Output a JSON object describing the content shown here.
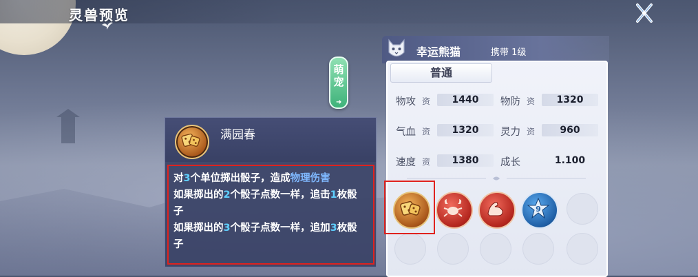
{
  "header": {
    "title": "灵兽预览"
  },
  "cute_tag": {
    "label": "萌宠"
  },
  "skill_popup": {
    "name": "满园春",
    "lines": [
      {
        "parts": [
          {
            "t": "对"
          },
          {
            "t": "3",
            "c": "cyan"
          },
          {
            "t": "个单位掷出骰子，造成"
          },
          {
            "t": "物理伤害",
            "c": "blue"
          }
        ]
      },
      {
        "parts": [
          {
            "t": "如果掷出的"
          },
          {
            "t": "2",
            "c": "cyan"
          },
          {
            "t": "个骰子点数一样，追击"
          },
          {
            "t": "1",
            "c": "cyan"
          },
          {
            "t": "枚骰"
          }
        ]
      },
      {
        "parts": [
          {
            "t": "子"
          }
        ]
      },
      {
        "parts": [
          {
            "t": "如果掷出的"
          },
          {
            "t": "3",
            "c": "cyan"
          },
          {
            "t": "个骰子点数一样，追加"
          },
          {
            "t": "3",
            "c": "cyan"
          },
          {
            "t": "枚骰"
          }
        ]
      },
      {
        "parts": [
          {
            "t": "子"
          }
        ]
      }
    ]
  },
  "pet": {
    "name": "幸运熊猫",
    "carry_label": "携带 1级",
    "tab": "普通",
    "stats": [
      {
        "label": "物攻",
        "zi": "资",
        "value": "1440"
      },
      {
        "label": "物防",
        "zi": "资",
        "value": "1320"
      },
      {
        "label": "气血",
        "zi": "资",
        "value": "1320"
      },
      {
        "label": "灵力",
        "zi": "资",
        "value": "960"
      },
      {
        "label": "速度",
        "zi": "资",
        "value": "1380"
      },
      {
        "label": "成长",
        "zi": "",
        "value": "1.100"
      }
    ],
    "skills": [
      {
        "icon": "dice-skill-icon"
      },
      {
        "icon": "crab-skill-icon"
      },
      {
        "icon": "muscle-skill-icon"
      },
      {
        "icon": "star-nine-skill-icon"
      }
    ]
  },
  "colors": {
    "highlight_cyan": "#5fd0ff",
    "highlight_blue": "#7fb8ff",
    "selection_red": "#e0221e"
  }
}
